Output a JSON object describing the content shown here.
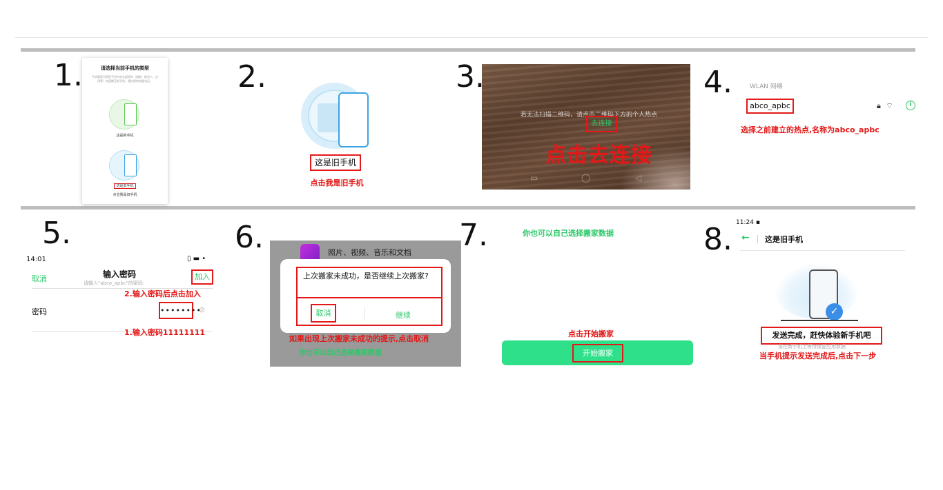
{
  "steps": {
    "s1": {
      "num": "1.",
      "title": "请选择当前手机的类型",
      "desc": "手机搬家可将旧手机中的全部资料（相册、联系人、应用等）快速搬至新手机，建议保持电量充足。",
      "new_phone_label": "这是新手机",
      "old_phone_label": "这是旧手机",
      "hint": "点击我是旧手机"
    },
    "s2": {
      "num": "2.",
      "old_phone_label": "这是旧手机",
      "hint": "点击我是旧手机"
    },
    "s3": {
      "num": "3.",
      "scan_text": "若无法扫描二维码，请点击二维码下方的个人热点",
      "connect_button": "去连接",
      "hint": "点击去连接"
    },
    "s4": {
      "num": "4.",
      "section_header": "WLAN 网络",
      "ssid": "abco_apbc",
      "hint": "选择之前建立的热点,名称为abco_apbc"
    },
    "s5": {
      "num": "5.",
      "status_time": "14:01",
      "cancel": "取消",
      "title": "输入密码",
      "subtitle": "请输入\"abco_apbc\"的密码:",
      "join": "加入",
      "hint_join": "2.输入密码后点击加入",
      "password_label": "密码",
      "password_value": "••••••••",
      "hint_password": "1.输入密码11111111"
    },
    "s6": {
      "num": "6.",
      "app_row": "照片、视频、音乐和文档",
      "message": "上次搬家未成功，是否继续上次搬家?",
      "cancel": "取消",
      "continue": "继续",
      "hint": "如果出现上次搬家未成功的提示,点击取消",
      "hint2": "你也可以自己选择搬家数据"
    },
    "s7": {
      "num": "7.",
      "top_hint": "你也可以自己选择搬家数据",
      "hint": "点击开始搬家",
      "start_button": "开始搬家"
    },
    "s8": {
      "num": "8.",
      "status_time": "11:24",
      "title": "这是旧手机",
      "done": "发送完成，赶快体验新手机吧",
      "sub": "请在新手机上等待恢复应用数据",
      "hint": "当手机提示发送完成后,点击下一步"
    }
  },
  "icons": {
    "back": "arrow-left-icon",
    "lock": "lock-icon",
    "wifi": "wifi-icon",
    "info": "info-icon",
    "eye": "eye-off-icon",
    "check": "check-icon"
  },
  "colors": {
    "accent_red": "#e31818",
    "accent_green": "#2dc86a",
    "button_green": "#2fe08a",
    "phone_blue": "#3aa4e0"
  }
}
